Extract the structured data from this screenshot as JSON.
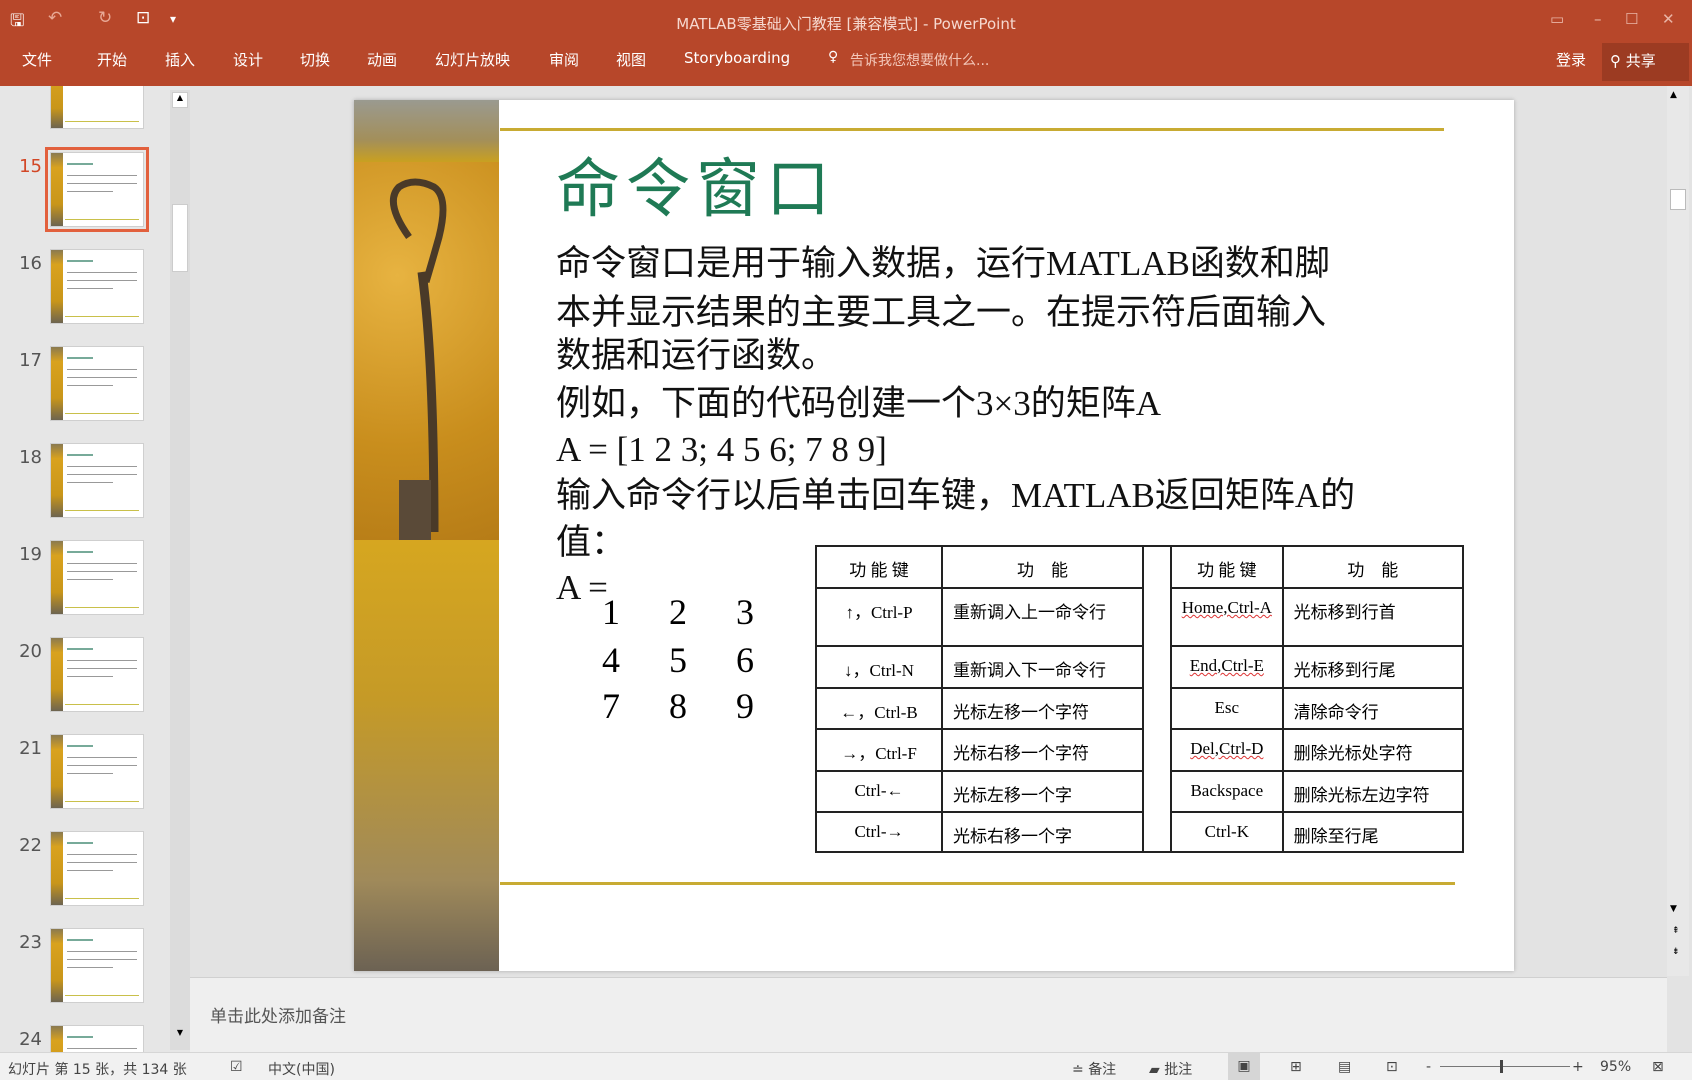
{
  "app": {
    "title": "MATLAB零基础入门教程 [兼容模式] - PowerPoint"
  },
  "ribbon": {
    "tabs": [
      "文件",
      "开始",
      "插入",
      "设计",
      "切换",
      "动画",
      "幻灯片放映",
      "审阅",
      "视图",
      "Storyboarding"
    ],
    "tell_me": "告诉我您想要做什么...",
    "login": "登录",
    "share": "共享"
  },
  "thumbnails": {
    "selected": 15,
    "items": [
      "15",
      "16",
      "17",
      "18",
      "19",
      "20",
      "21",
      "22",
      "23",
      "24"
    ]
  },
  "slide": {
    "title": "命令窗口",
    "lines": [
      "命令窗口是用于输入数据，运行MATLAB函数和脚",
      "本并显示结果的主要工具之一。在提示符后面输入",
      "数据和运行函数。",
      "例如，下面的代码创建一个3×3的矩阵A",
      "A = [1 2 3; 4 5 6; 7 8 9]",
      "输入命令行以后单击回车键，MATLAB返回矩阵A的",
      "值：",
      "A ="
    ],
    "matrix": [
      [
        "1",
        "2",
        "3"
      ],
      [
        "4",
        "5",
        "6"
      ],
      [
        "7",
        "8",
        "9"
      ]
    ],
    "table": {
      "headers": [
        "功 能 键",
        "功　能",
        "功 能 键",
        "功　能"
      ],
      "left": [
        [
          "↑，Ctrl-P",
          "重新调入上一命令行"
        ],
        [
          "↓，Ctrl-N",
          "重新调入下一命令行"
        ],
        [
          "←，Ctrl-B",
          "光标左移一个字符"
        ],
        [
          "→，Ctrl-F",
          "光标右移一个字符"
        ],
        [
          "Ctrl-←",
          "光标左移一个字"
        ],
        [
          "Ctrl-→",
          "光标右移一个字"
        ]
      ],
      "right": [
        [
          "Home,Ctrl-A",
          "光标移到行首"
        ],
        [
          "End,Ctrl-E",
          "光标移到行尾"
        ],
        [
          "Esc",
          "清除命令行"
        ],
        [
          "Del,Ctrl-D",
          "删除光标处字符"
        ],
        [
          "Backspace",
          "删除光标左边字符"
        ],
        [
          "Ctrl-K",
          "删除至行尾"
        ]
      ]
    }
  },
  "notes": {
    "placeholder": "单击此处添加备注"
  },
  "status": {
    "slide_info": "幻灯片 第 15 张，共 134 张",
    "language": "中文(中国)",
    "notes": "备注",
    "comments": "批注",
    "zoom": "95%",
    "zoom_level": 95
  },
  "colors": {
    "ribbon": "#b7472a",
    "title": "#1f7a55",
    "rule": "#c8ab33",
    "selected": "#e2603d"
  }
}
